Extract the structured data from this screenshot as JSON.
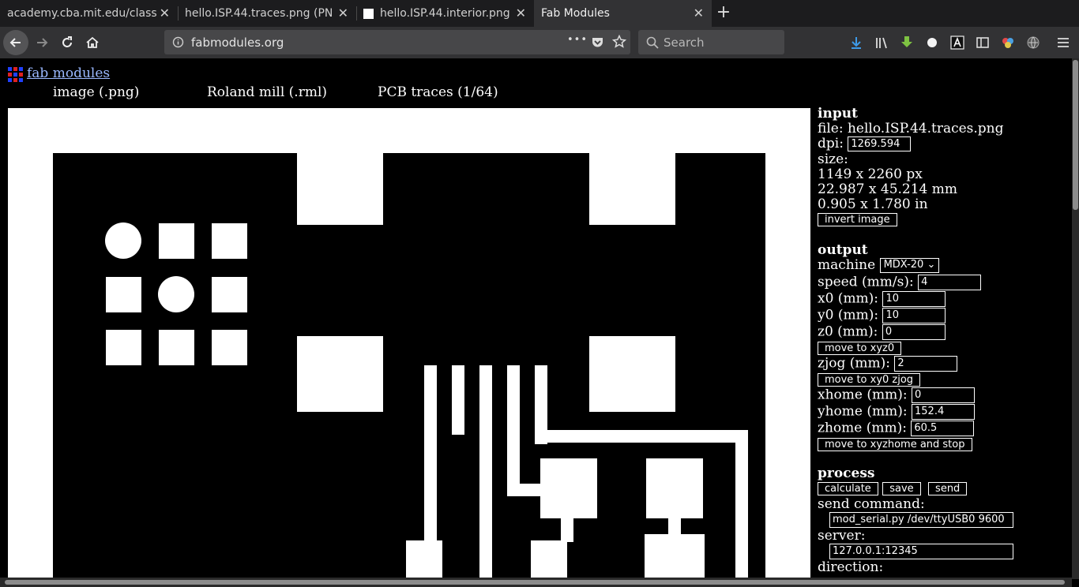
{
  "browser": {
    "tabs": [
      {
        "label": "academy.cba.mit.edu/class",
        "active": false
      },
      {
        "label": "hello.ISP.44.traces.png (PN",
        "active": false
      },
      {
        "label": "hello.ISP.44.interior.png",
        "active": false
      },
      {
        "label": "Fab Modules",
        "active": true
      }
    ],
    "close_glyph": "✕",
    "new_tab_glyph": "+",
    "url": "fabmodules.org",
    "url_actions_glyph": "•••",
    "search_placeholder": "Search"
  },
  "page": {
    "site_link": "fab modules",
    "menu": {
      "image": "image (.png)",
      "machine": "Roland mill (.rml)",
      "process": "PCB traces (1/64)"
    },
    "input": {
      "title": "input",
      "file_label": "file:",
      "file_name": "hello.ISP.44.traces.png",
      "dpi_label": "dpi:",
      "dpi_value": "1269.594",
      "size_label": "size:",
      "size_px": "1149 x 2260 px",
      "size_mm": "22.987 x 45.214 mm",
      "size_in": "0.905 x 1.780 in",
      "invert_button": "invert image"
    },
    "output": {
      "title": "output",
      "machine_label": "machine",
      "machine_value": "MDX-20",
      "speed_label": "speed (mm/s):",
      "speed_value": "4",
      "x0_label": "x0 (mm):",
      "x0_value": "10",
      "y0_label": "y0 (mm):",
      "y0_value": "10",
      "z0_label": "z0 (mm):",
      "z0_value": "0",
      "move_xyz0": "move to xyz0",
      "zjog_label": "zjog (mm):",
      "zjog_value": "2",
      "move_xy0zjog": "move to xy0 zjog",
      "xhome_label": "xhome (mm):",
      "xhome_value": "0",
      "yhome_label": "yhome (mm):",
      "yhome_value": "152.4",
      "zhome_label": "zhome (mm):",
      "zhome_value": "60.5",
      "move_home": "move to xyzhome and stop"
    },
    "process": {
      "title": "process",
      "calculate": "calculate",
      "save": "save",
      "send": "send",
      "send_command_label": "send command:",
      "send_command_value": "mod_serial.py /dev/ttyUSB0 9600",
      "server_label": "server:",
      "server_value": "127.0.0.1:12345",
      "direction_label": "direction:"
    }
  },
  "colors": {
    "tab_bar": "#1c1c1e",
    "toolbar": "#323234",
    "link": "#9ab8ff",
    "accent_download": "#3d9ae8"
  }
}
